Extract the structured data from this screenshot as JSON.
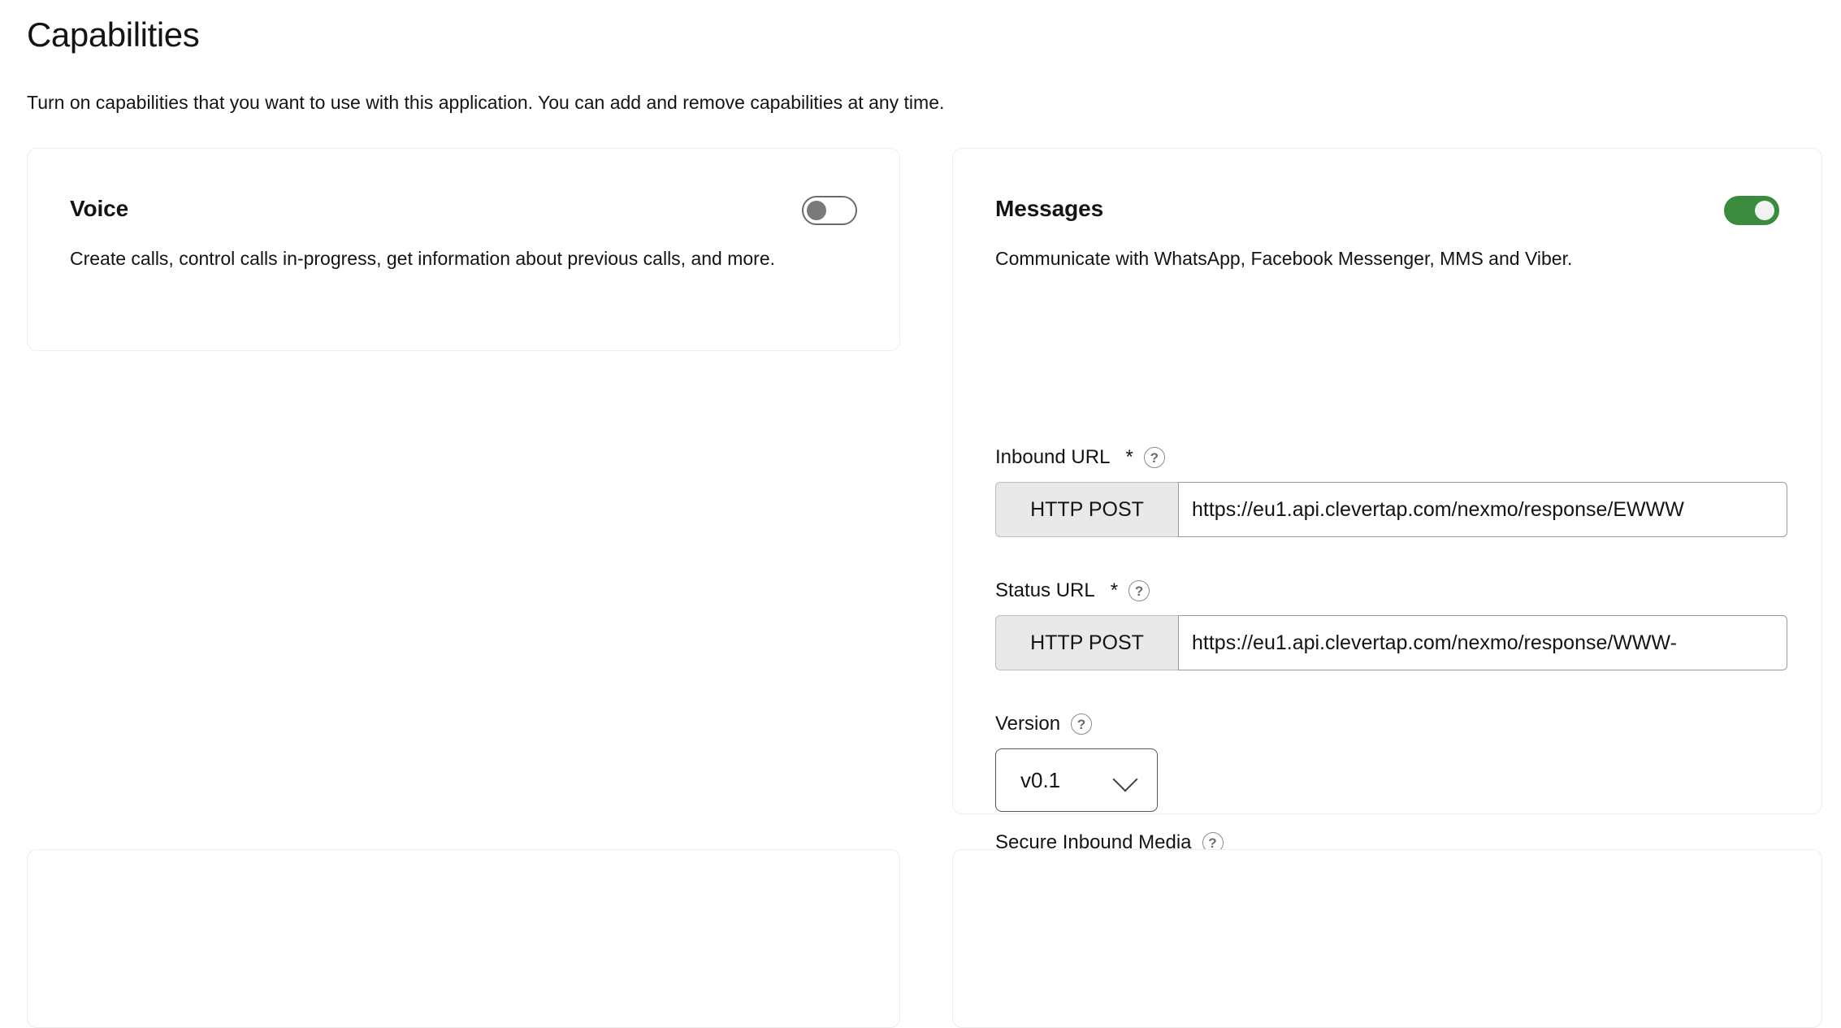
{
  "page": {
    "title": "Capabilities",
    "subtitle": "Turn on capabilities that you want to use with this application. You can add and remove capabilities at any time."
  },
  "colors": {
    "accent_on": "#3a8b3e",
    "toggle_off_knob": "#7a7a7a",
    "card_border": "#ececec",
    "chip_background": "#e8e9ea",
    "text": "#131415"
  },
  "cards": {
    "voice": {
      "title": "Voice",
      "description": "Create calls, control calls in-progress, get information about previous calls, and more.",
      "toggle": {
        "name": "voice-toggle",
        "state": "off"
      }
    },
    "messages": {
      "title": "Messages",
      "description": "Communicate with WhatsApp, Facebook Messenger, MMS and Viber.",
      "toggle": {
        "name": "messages-toggle",
        "state": "on"
      },
      "fields": {
        "inbound_url": {
          "label": "Inbound URL",
          "required_marker": "*",
          "help_glyph": "?",
          "method": "HTTP POST",
          "value": "https://eu1.api.clevertap.com/nexmo/response/EWWW",
          "placeholder": ""
        },
        "status_url": {
          "label": "Status URL",
          "required_marker": "*",
          "help_glyph": "?",
          "method": "HTTP POST",
          "value": "https://eu1.api.clevertap.com/nexmo/response/WWW-",
          "placeholder": ""
        },
        "version": {
          "label": "Version",
          "help_glyph": "?",
          "selected": "v0.1",
          "chevron": "chevron-down-icon"
        },
        "secure_inbound_media": {
          "label": "Secure Inbound Media",
          "help_glyph": "?",
          "toggle": {
            "name": "secure-inbound-media-toggle",
            "state": "off"
          }
        }
      }
    }
  }
}
